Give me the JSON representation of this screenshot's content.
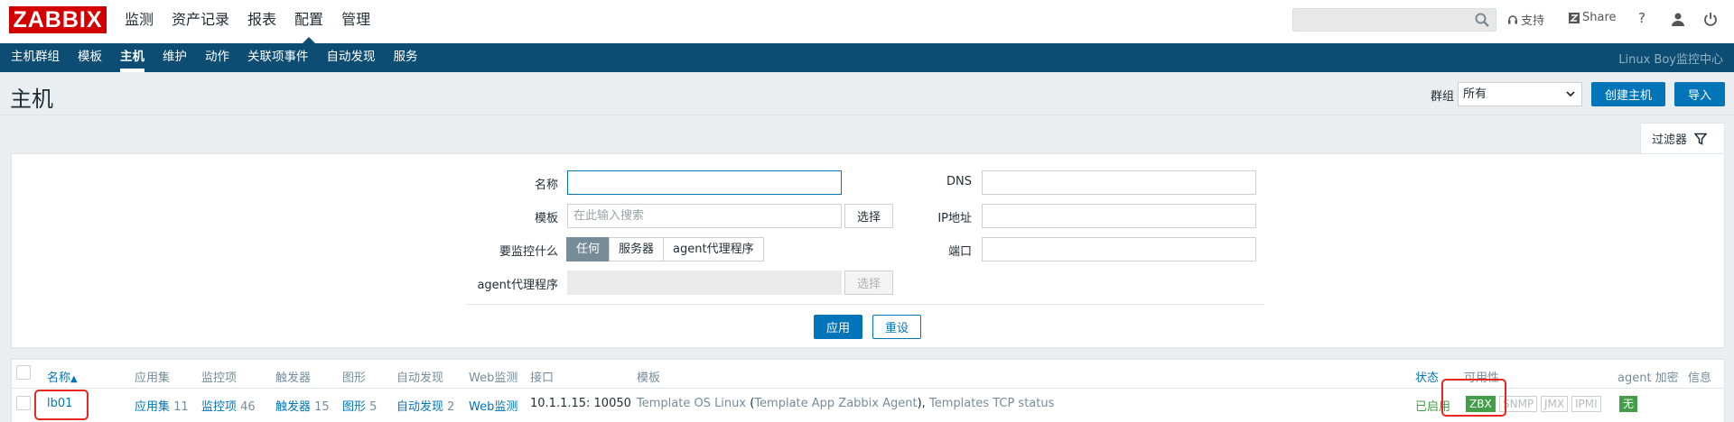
{
  "logo": "ZABBIX",
  "main_menu": [
    "监测",
    "资产记录",
    "报表",
    "配置",
    "管理"
  ],
  "main_menu_active": "配置",
  "top_tools": {
    "support": "支持",
    "share": "Share",
    "help": "?"
  },
  "sub_menu": [
    "主机群组",
    "模板",
    "主机",
    "维护",
    "动作",
    "关联项事件",
    "自动发现",
    "服务"
  ],
  "sub_menu_active": "主机",
  "server_name": "Linux Boy监控中心",
  "page_title": "主机",
  "group_filter": {
    "label": "群组",
    "selected": "所有"
  },
  "buttons": {
    "create_host": "创建主机",
    "import": "导入"
  },
  "filter": {
    "tab_label": "过滤器",
    "name_label": "名称",
    "name_value": "",
    "template_label": "模板",
    "template_placeholder": "在此输入搜索",
    "template_select": "选择",
    "monitored_by_label": "要监控什么",
    "monitored_by_options": [
      "任何",
      "服务器",
      "agent代理程序"
    ],
    "monitored_by_selected": "任何",
    "proxy_label": "agent代理程序",
    "proxy_select": "选择",
    "dns_label": "DNS",
    "ip_label": "IP地址",
    "port_label": "端口",
    "apply": "应用",
    "reset": "重设"
  },
  "table": {
    "headers": {
      "name": "名称",
      "applications": "应用集",
      "items": "监控项",
      "triggers": "触发器",
      "graphs": "图形",
      "discovery": "自动发现",
      "web": "Web监测",
      "interface": "接口",
      "templates": "模板",
      "status": "状态",
      "availability": "可用性",
      "encryption": "agent 加密",
      "info": "信息"
    },
    "sort_indicator": "▲",
    "rows": [
      {
        "name": "lb01",
        "applications": {
          "label": "应用集",
          "count": "11"
        },
        "items": {
          "label": "监控项",
          "count": "46"
        },
        "triggers": {
          "label": "触发器",
          "count": "15"
        },
        "graphs": {
          "label": "图形",
          "count": "5"
        },
        "discovery": {
          "label": "自动发现",
          "count": "2"
        },
        "web": "Web监测",
        "interface": "10.1.1.15: 10050",
        "templates": {
          "t1": "Template OS Linux",
          "open": "(",
          "t2": "Template App Zabbix Agent",
          "close": "),",
          "t3": "Templates TCP status"
        },
        "status": "已启用",
        "availability": [
          "ZBX",
          "SNMP",
          "JMX",
          "IPMI"
        ],
        "encryption": "无"
      }
    ]
  },
  "colors": {
    "brand_red": "#d40000",
    "nav_blue": "#0e4d73",
    "link_blue": "#0275b8",
    "ok_green": "#429e47",
    "highlight_red": "#e8271f"
  }
}
